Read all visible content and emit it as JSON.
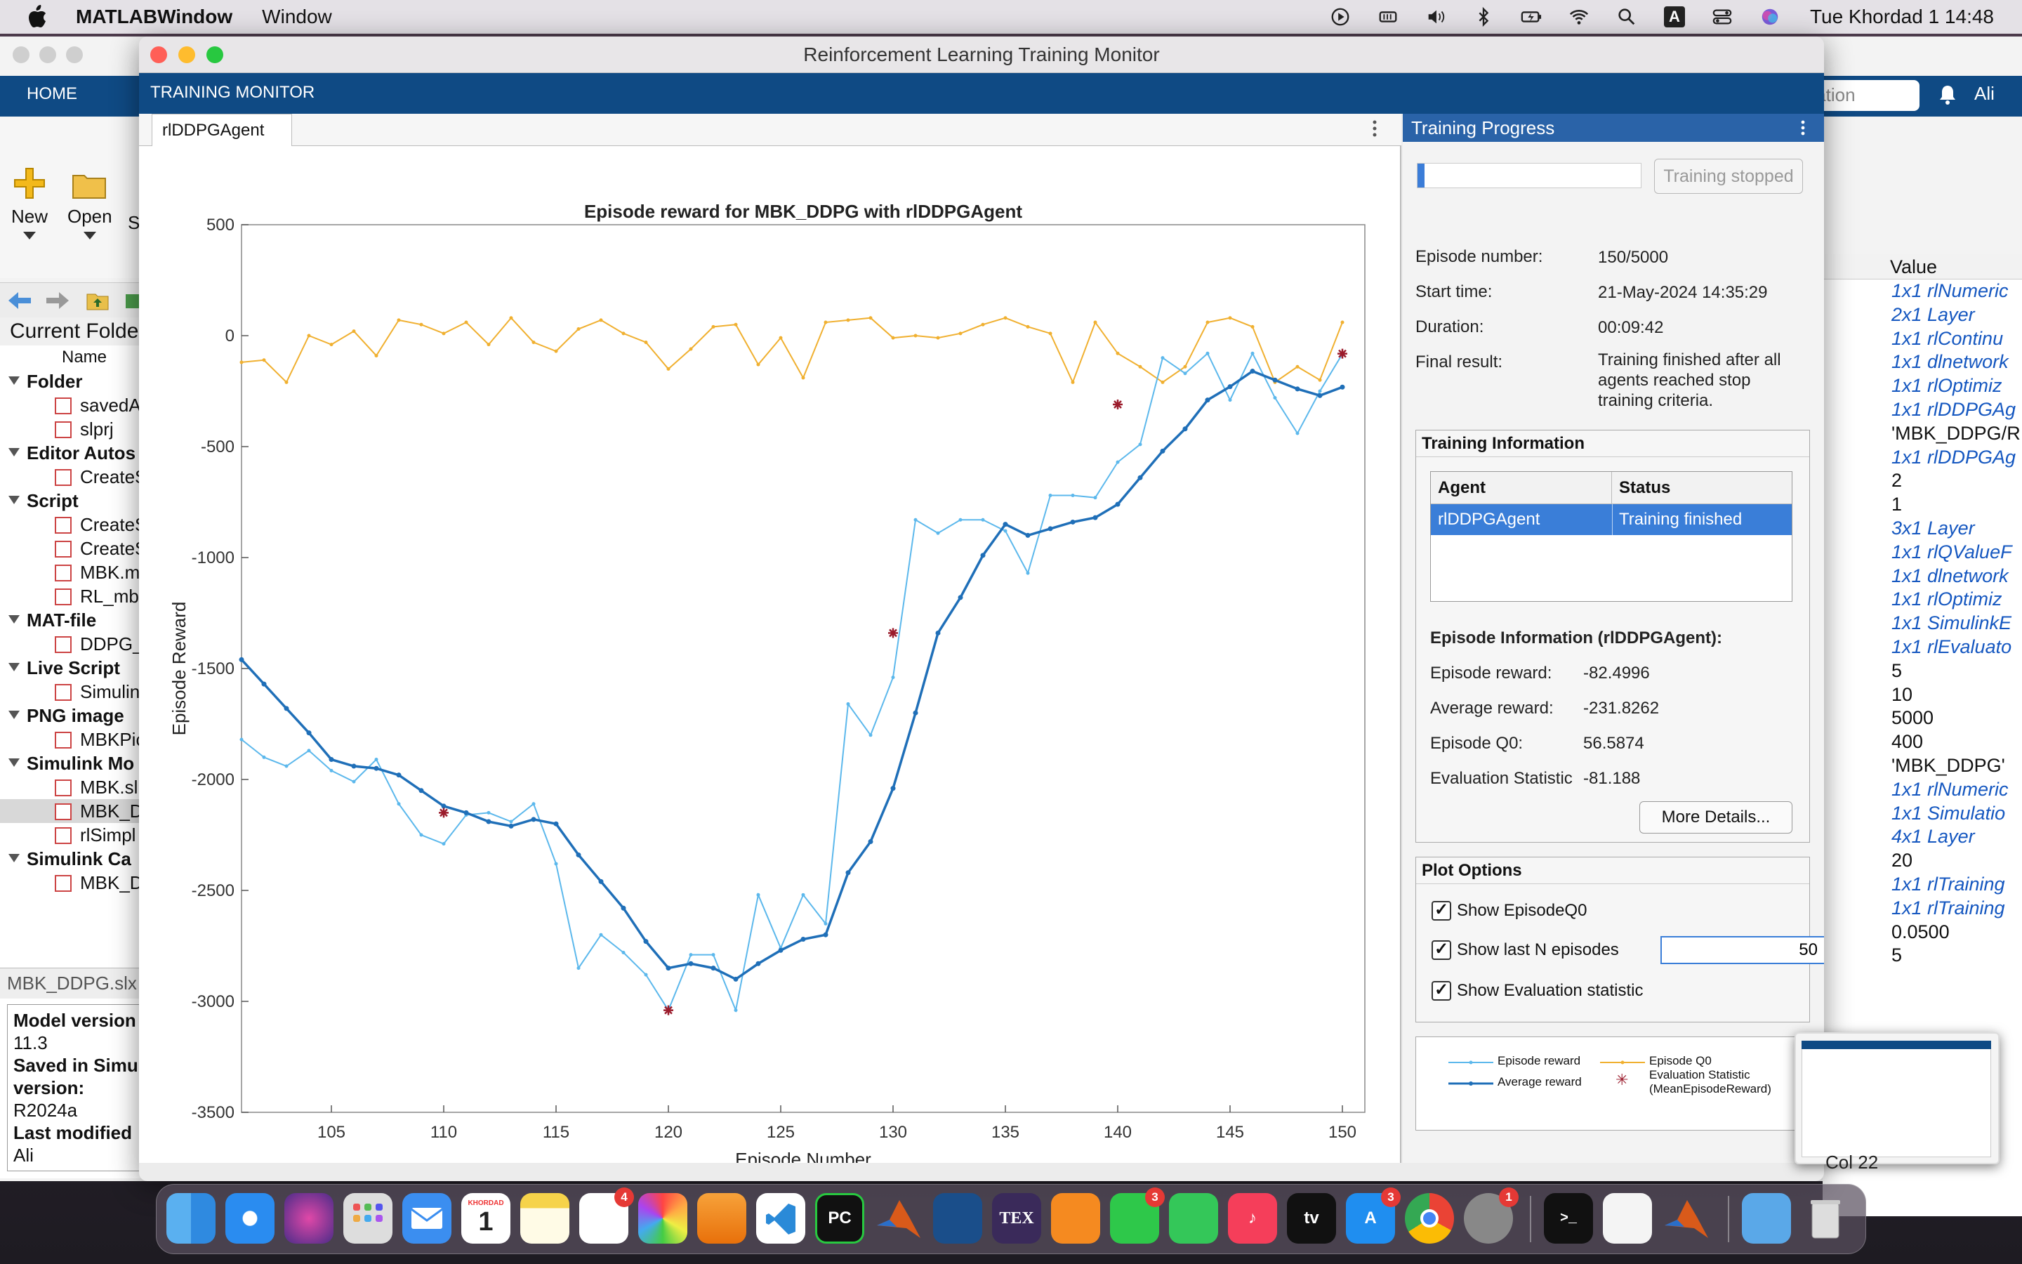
{
  "menubar": {
    "app_name": "MATLABWindow",
    "menus": [
      "Window"
    ],
    "input_badge": "A",
    "clock": "Tue Khordad 1  14:48"
  },
  "background_matlab": {
    "tab_home": "HOME",
    "search_placeholder": "entation",
    "user": "Ali",
    "toolbar": {
      "new": "New",
      "open": "Open",
      "s": "S"
    },
    "current_folder_title": "Current Folde",
    "name_col": "Name",
    "tree": [
      {
        "type": "group",
        "label": "Folder"
      },
      {
        "type": "item",
        "label": "savedA"
      },
      {
        "type": "item",
        "label": "slprj"
      },
      {
        "type": "group",
        "label": "Editor Autos"
      },
      {
        "type": "item",
        "label": "CreateS"
      },
      {
        "type": "group",
        "label": "Script"
      },
      {
        "type": "item",
        "label": "CreateS"
      },
      {
        "type": "item",
        "label": "CreateS"
      },
      {
        "type": "item",
        "label": "MBK.m"
      },
      {
        "type": "item",
        "label": "RL_mb"
      },
      {
        "type": "group",
        "label": "MAT-file"
      },
      {
        "type": "item",
        "label": "DDPG_"
      },
      {
        "type": "group",
        "label": "Live Script"
      },
      {
        "type": "item",
        "label": "Simulin"
      },
      {
        "type": "group",
        "label": "PNG image"
      },
      {
        "type": "item",
        "label": "MBKPic"
      },
      {
        "type": "group",
        "label": "Simulink Mo"
      },
      {
        "type": "item",
        "label": "MBK.sl"
      },
      {
        "type": "item",
        "label": "MBK_D",
        "selected": true
      },
      {
        "type": "item",
        "label": "rlSimpl"
      },
      {
        "type": "group",
        "label": "Simulink Ca"
      },
      {
        "type": "item",
        "label": "MBK_D"
      }
    ],
    "details_title": "MBK_DDPG.slx",
    "details_lines": [
      {
        "text": "Model version",
        "bold": true
      },
      {
        "text": "11.3",
        "bold": false
      },
      {
        "text": "Saved in Simu",
        "bold": true
      },
      {
        "text": "version:",
        "bold": true
      },
      {
        "text": "R2024a",
        "bold": false
      },
      {
        "text": "Last modified",
        "bold": true
      },
      {
        "text": "Ali",
        "bold": false
      }
    ],
    "workspace_value_header": "Value",
    "workspace_values": [
      {
        "text": "1x1 rlNumeric",
        "italic": true
      },
      {
        "text": "2x1 Layer",
        "italic": true
      },
      {
        "text": "1x1 rlContinu",
        "italic": true
      },
      {
        "text": "1x1 dlnetwork",
        "italic": true
      },
      {
        "text": "1x1 rlOptimiz",
        "italic": true
      },
      {
        "text": "1x1 rlDDPGAg",
        "italic": true
      },
      {
        "text": "'MBK_DDPG/RI",
        "italic": false
      },
      {
        "text": "1x1 rlDDPGAg",
        "italic": true
      },
      {
        "text": "2",
        "italic": false
      },
      {
        "text": "1",
        "italic": false
      },
      {
        "text": "3x1 Layer",
        "italic": true
      },
      {
        "text": "1x1 rlQValueF",
        "italic": true
      },
      {
        "text": "1x1 dlnetwork",
        "italic": true
      },
      {
        "text": "1x1 rlOptimiz",
        "italic": true
      },
      {
        "text": "1x1 SimulinkE",
        "italic": true
      },
      {
        "text": "1x1 rlEvaluato",
        "italic": true
      },
      {
        "text": "5",
        "italic": false
      },
      {
        "text": "10",
        "italic": false
      },
      {
        "text": "5000",
        "italic": false
      },
      {
        "text": "400",
        "italic": false
      },
      {
        "text": "'MBK_DDPG'",
        "italic": false
      },
      {
        "text": "1x1 rlNumeric",
        "italic": true
      },
      {
        "text": "1x1 Simulatio",
        "italic": true
      },
      {
        "text": "4x1 Layer",
        "italic": true
      },
      {
        "text": "20",
        "italic": false
      },
      {
        "text": "1x1 rlTraining",
        "italic": true
      },
      {
        "text": "1x1 rlTraining",
        "italic": true
      },
      {
        "text": "0.0500",
        "italic": false
      },
      {
        "text": "5",
        "italic": false
      }
    ],
    "status_text": "Col  22"
  },
  "window": {
    "title": "Reinforcement Learning Training Monitor",
    "toolstrip_tab": "TRAINING MONITOR",
    "doc_tab": "rlDDPGAgent"
  },
  "training_progress": {
    "header": "Training Progress",
    "progress_fraction": 0.03,
    "stop_button": "Training stopped",
    "episode_number_label": "Episode number:",
    "episode_number": "150/5000",
    "start_time_label": "Start time:",
    "start_time": "21-May-2024 14:35:29",
    "duration_label": "Duration:",
    "duration": "00:09:42",
    "final_result_label": "Final result:",
    "final_result": "Training finished after all agents reached stop training criteria.",
    "training_info_title": "Training Information",
    "agent_col": "Agent",
    "status_col": "Status",
    "agent_name": "rlDDPGAgent",
    "agent_status": "Training finished",
    "episode_info_title": "Episode Information (rlDDPGAgent):",
    "episode_reward_label": "Episode reward:",
    "episode_reward": "-82.4996",
    "average_reward_label": "Average reward:",
    "average_reward": "-231.8262",
    "episode_q0_label": "Episode Q0:",
    "episode_q0": "56.5874",
    "eval_stat_label": "Evaluation Statistic",
    "eval_stat": "-81.188",
    "more_details": "More Details...",
    "plot_options_title": "Plot Options",
    "show_q0": "Show EpisodeQ0",
    "show_last_n": "Show last N episodes",
    "last_n_value": "50",
    "show_eval": "Show Evaluation statistic",
    "legend": {
      "episode_reward": "Episode reward",
      "average_reward": "Average reward",
      "episode_q0": "Episode Q0",
      "eval_stat_1": "Evaluation Statistic",
      "eval_stat_2": "(MeanEpisodeReward)"
    }
  },
  "colors": {
    "toolstrip_blue": "#0f4a84",
    "selection_blue": "#3a7ed8",
    "episode_reward": "#5cb8ec",
    "average_reward": "#1f6fb8",
    "episode_q0": "#f0b030",
    "evaluation": "#9b1c2c"
  },
  "chart_data": {
    "type": "line",
    "title": "Episode reward for MBK_DDPG with rlDDPGAgent",
    "xlabel": "Episode Number",
    "ylabel": "Episode Reward",
    "xlim": [
      101,
      151
    ],
    "ylim": [
      -3500,
      500
    ],
    "xticks": [
      105,
      110,
      115,
      120,
      125,
      130,
      135,
      140,
      145,
      150
    ],
    "yticks": [
      500,
      0,
      -500,
      -1000,
      -1500,
      -2000,
      -2500,
      -3000,
      -3500
    ],
    "legend_placement": "separate panel",
    "series": [
      {
        "name": "Episode reward",
        "x": [
          101,
          102,
          103,
          104,
          105,
          106,
          107,
          108,
          109,
          110,
          111,
          112,
          113,
          114,
          115,
          116,
          117,
          118,
          119,
          120,
          121,
          122,
          123,
          124,
          125,
          126,
          127,
          128,
          129,
          130,
          131,
          132,
          133,
          134,
          135,
          136,
          137,
          138,
          139,
          140,
          141,
          142,
          143,
          144,
          145,
          146,
          147,
          148,
          149,
          150
        ],
        "values": [
          -1820,
          -1900,
          -1940,
          -1870,
          -1960,
          -2010,
          -1910,
          -2110,
          -2250,
          -2290,
          -2160,
          -2150,
          -2190,
          -2110,
          -2380,
          -2850,
          -2700,
          -2780,
          -2880,
          -3040,
          -2790,
          -2790,
          -3040,
          -2520,
          -2760,
          -2520,
          -2650,
          -1660,
          -1800,
          -1540,
          -830,
          -890,
          -830,
          -830,
          -880,
          -1070,
          -720,
          -720,
          -730,
          -570,
          -490,
          -100,
          -170,
          -80,
          -290,
          -80,
          -280,
          -440,
          -250,
          -82.5
        ]
      },
      {
        "name": "Average reward",
        "x": [
          101,
          102,
          103,
          104,
          105,
          106,
          107,
          108,
          109,
          110,
          111,
          112,
          113,
          114,
          115,
          116,
          117,
          118,
          119,
          120,
          121,
          122,
          123,
          124,
          125,
          126,
          127,
          128,
          129,
          130,
          131,
          132,
          133,
          134,
          135,
          136,
          137,
          138,
          139,
          140,
          141,
          142,
          143,
          144,
          145,
          146,
          147,
          148,
          149,
          150
        ],
        "values": [
          -1460,
          -1570,
          -1680,
          -1790,
          -1910,
          -1940,
          -1950,
          -1980,
          -2050,
          -2120,
          -2150,
          -2190,
          -2210,
          -2180,
          -2200,
          -2340,
          -2460,
          -2580,
          -2730,
          -2850,
          -2830,
          -2850,
          -2900,
          -2830,
          -2770,
          -2720,
          -2700,
          -2420,
          -2280,
          -2040,
          -1700,
          -1340,
          -1180,
          -990,
          -850,
          -900,
          -870,
          -840,
          -820,
          -760,
          -640,
          -520,
          -420,
          -290,
          -230,
          -160,
          -200,
          -240,
          -270,
          -231.8
        ]
      },
      {
        "name": "Episode Q0",
        "x": [
          101,
          102,
          103,
          104,
          105,
          106,
          107,
          108,
          109,
          110,
          111,
          112,
          113,
          114,
          115,
          116,
          117,
          118,
          119,
          120,
          121,
          122,
          123,
          124,
          125,
          126,
          127,
          128,
          129,
          130,
          131,
          132,
          133,
          134,
          135,
          136,
          137,
          138,
          139,
          140,
          141,
          142,
          143,
          144,
          145,
          146,
          147,
          148,
          149,
          150
        ],
        "values": [
          -120,
          -110,
          -210,
          0,
          -40,
          20,
          -90,
          70,
          50,
          10,
          60,
          -40,
          80,
          -30,
          -70,
          30,
          70,
          10,
          -30,
          -150,
          -60,
          40,
          50,
          -130,
          -10,
          -190,
          60,
          70,
          80,
          -10,
          0,
          -10,
          10,
          50,
          80,
          40,
          10,
          -210,
          60,
          -80,
          -140,
          -210,
          -140,
          60,
          80,
          40,
          -210,
          -140,
          -200,
          60
        ]
      },
      {
        "name": "Evaluation Statistic (MeanEpisodeReward)",
        "x": [
          110,
          120,
          130,
          140,
          150
        ],
        "values": [
          -2150,
          -3040,
          -1340,
          -310,
          -81.188
        ]
      }
    ]
  }
}
